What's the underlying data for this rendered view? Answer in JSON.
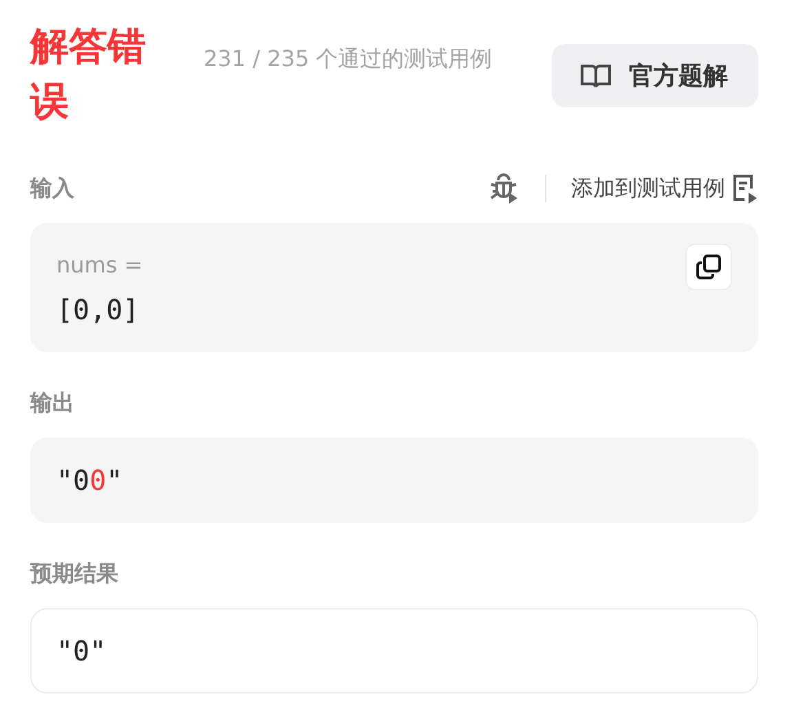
{
  "result": {
    "title": "解答错误",
    "summary": "231 / 235 个通过的测试用例",
    "solution_button": "官方题解"
  },
  "input": {
    "label": "输入",
    "add_to_tests": "添加到测试用例",
    "params": [
      {
        "name": "nums =",
        "value": "[0,0]"
      }
    ]
  },
  "output": {
    "label": "输出",
    "segments": [
      {
        "text": "\"0",
        "diff": false
      },
      {
        "text": "0",
        "diff": true
      },
      {
        "text": "\"",
        "diff": false
      }
    ]
  },
  "expected": {
    "label": "预期结果",
    "value": "\"0\""
  }
}
